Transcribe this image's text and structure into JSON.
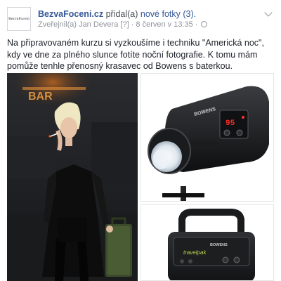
{
  "post": {
    "avatar_text": "BezvaFoceni",
    "author": "BezvaFoceni.cz",
    "action": " přidal(a) ",
    "action_link": "nové fotky (3).",
    "meta": {
      "published_by": "Zveřejnil(a) Jan Devera",
      "help": "[?]",
      "separator": " · ",
      "date": "8 červen v 13:35",
      "separator2": " · "
    },
    "text": "Na připravovaném kurzu si vyzkoušíme i techniku \"Americká noc\", kdy ve dne za plného slunce fotíte noční fotografie. K tomu mám pomůže tenhle přenosný krasavec od Bowens s baterkou.",
    "photos": [
      {
        "label": "woman-with-cigarette-photo",
        "neon_text": "BAR"
      },
      {
        "label": "bowens-flash-head-photo",
        "brand": "BOWENS",
        "display": "95"
      },
      {
        "label": "bowens-battery-pack-photo",
        "brand": "BOWENS",
        "model": "travelpak"
      }
    ]
  },
  "colors": {
    "link": "#365899",
    "meta": "#90949c",
    "text": "#1d2129"
  },
  "icons": [
    "globe-icon",
    "chevron-down-icon"
  ]
}
